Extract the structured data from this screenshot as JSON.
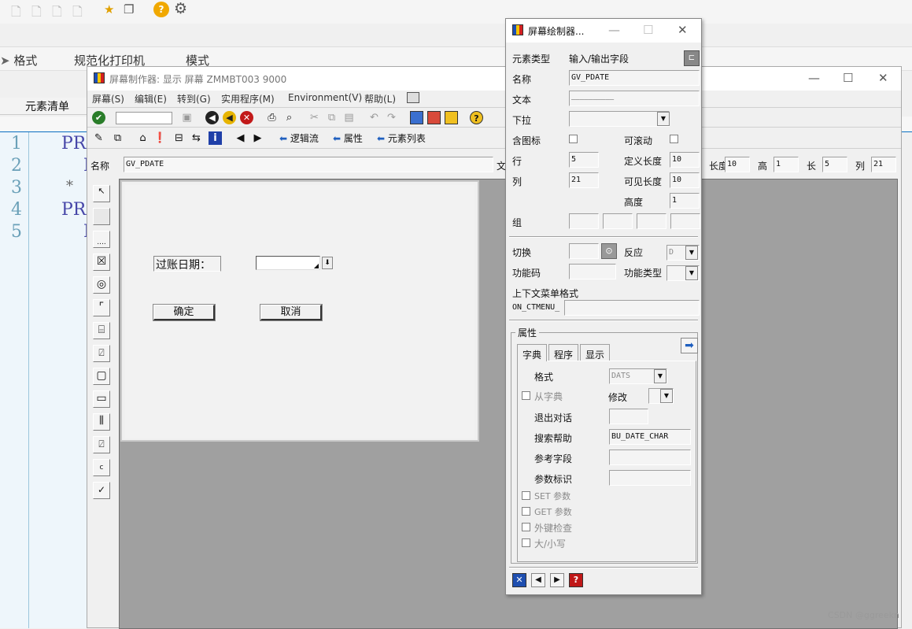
{
  "background": {
    "menu": [
      "格式",
      "规范化打印机",
      "模式"
    ],
    "strip_label": "元素清单",
    "line_numbers": [
      "1",
      "2",
      "3",
      "4",
      "5"
    ],
    "code_fragments": [
      "PRO",
      "M",
      "*",
      "PRO",
      "M"
    ]
  },
  "painter": {
    "title": "屏幕制作器:  显示 屏幕 ZMMBT003 9000",
    "menu": [
      "屏幕(S)",
      "编辑(E)",
      "转到(G)",
      "实用程序(M)",
      "Environment(V)",
      "帮助(L)"
    ],
    "toolbar2": {
      "logic_flow": "逻辑流",
      "attributes": "属性",
      "element_list": "元素列表"
    },
    "fieldbar": {
      "name_label": "名称",
      "name_value": "GV_PDATE",
      "text_label": "文",
      "deflen_label": "长度",
      "deflen_value": "10",
      "height_label": "高",
      "height_value": "1",
      "length_label": "长",
      "length_value": "5",
      "col_label": "列",
      "col_value": "21"
    },
    "canvas": {
      "date_label": "过账日期：",
      "ok_button": "确定",
      "cancel_button": "取消"
    }
  },
  "attr": {
    "title": "屏幕绘制器...",
    "element_type_label": "元素类型",
    "element_type_value": "输入/输出字段",
    "name_label": "名称",
    "name_value": "GV_PDATE",
    "text_label": "文本",
    "text_value": "__________",
    "dropdown_label": "下拉",
    "with_icon_label": "含图标",
    "scrollable_label": "可滚动",
    "row_label": "行",
    "row_value": "5",
    "deflen_label": "定义长度",
    "deflen_value": "10",
    "col_label": "列",
    "col_value": "21",
    "vislen_label": "可见长度",
    "vislen_value": "10",
    "height_label": "高度",
    "height_value": "1",
    "group_label": "组",
    "switch_label": "切换",
    "reaction_label": "反应",
    "reaction_value": "D",
    "fcode_label": "功能码",
    "fctype_label": "功能类型",
    "ctxmenu_label": "上下文菜单格式",
    "ctxmenu_value": "ON_CTMENU_",
    "props_label": "属性",
    "tabs": [
      "字典",
      "程序",
      "显示"
    ],
    "format_label": "格式",
    "format_value": "DATS",
    "from_dict_label": "从字典",
    "modify_label": "修改",
    "exit_dialog_label": "退出对话",
    "search_help_label": "搜索帮助",
    "search_help_value": "BU_DATE_CHAR",
    "ref_field_label": "参考字段",
    "param_id_label": "参数标识",
    "set_param_label": "SET 参数",
    "get_param_label": "GET 参数",
    "foreign_key_label": "外键检查",
    "case_label": "大/小写"
  },
  "watermark": "CSDN @ggreekn"
}
